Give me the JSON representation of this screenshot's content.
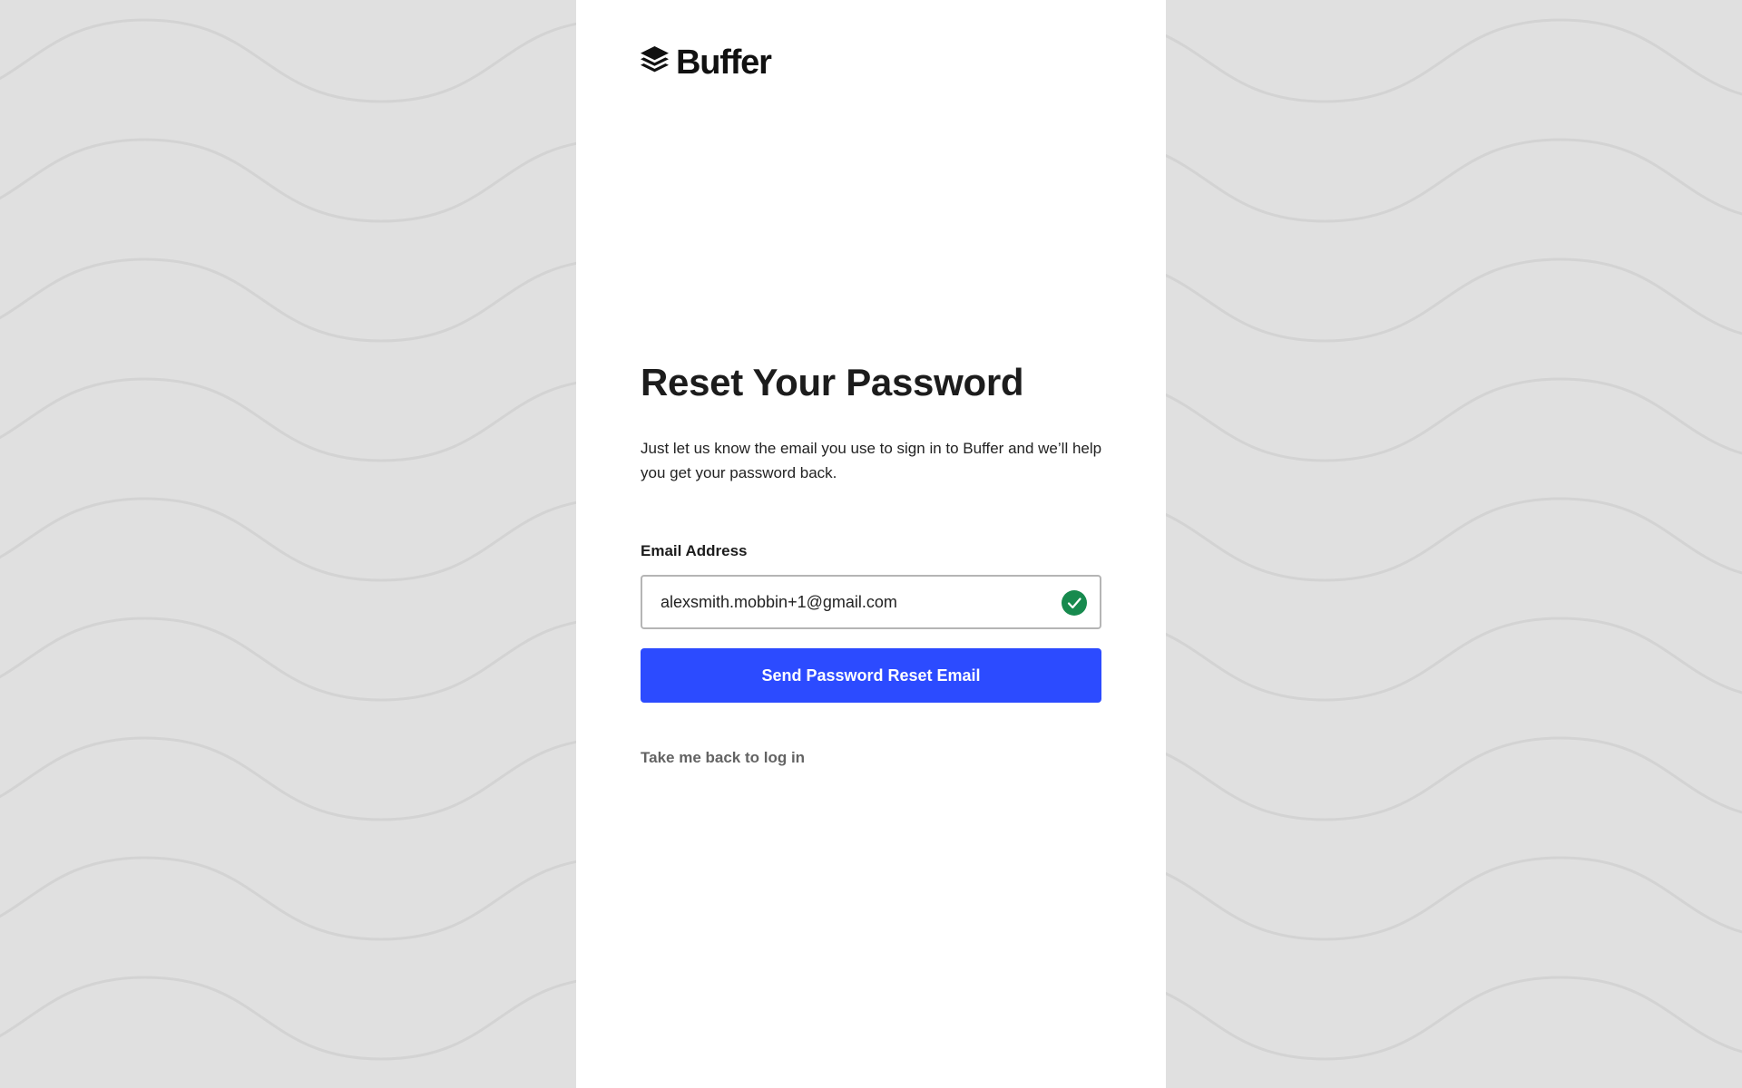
{
  "brand": {
    "name": "Buffer",
    "logo_icon": "buffer-layers-icon"
  },
  "page": {
    "title": "Reset Your Password",
    "description": "Just let us know the email you use to sign in to Buffer and we’ll help you get your password back."
  },
  "form": {
    "email_label": "Email Address",
    "email_value": "alexsmith.mobbin+1@gmail.com",
    "email_status_icon": "check-circle-icon",
    "submit_label": "Send Password Reset Email",
    "back_link_label": "Take me back to log in"
  },
  "colors": {
    "background": "#e0e0e0",
    "panel": "#ffffff",
    "primary_button": "#2c4bff",
    "valid_check": "#178a4e",
    "link": "#636363"
  }
}
